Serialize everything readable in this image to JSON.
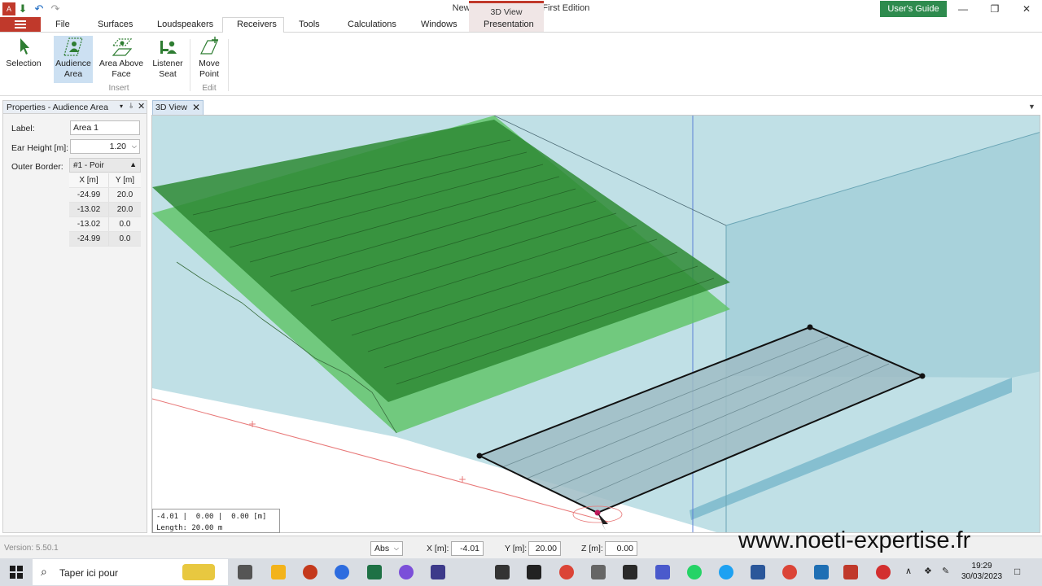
{
  "window": {
    "title": "New Project - EASE 5 First Edition",
    "context_group": "3D View",
    "users_guide": "User's Guide"
  },
  "tabs": [
    "File",
    "Surfaces",
    "Loudspeakers",
    "Receivers",
    "Tools",
    "Calculations",
    "Windows",
    "Presentation"
  ],
  "ribbon": {
    "selection": "Selection",
    "audience_area": "Audience\nArea",
    "area_above_face": "Area Above\nFace",
    "listener_seat": "Listener\nSeat",
    "move_point": "Move\nPoint",
    "group_insert": "Insert",
    "group_edit": "Edit"
  },
  "properties": {
    "title": "Properties - Audience Area",
    "label_caption": "Label:",
    "label_value": "Area 1",
    "ear_height_caption": "Ear Height [m]:",
    "ear_height_value": "1.20",
    "outer_border_caption": "Outer Border:",
    "outer_border_value": "#1 - Poir",
    "col_x": "X [m]",
    "col_y": "Y [m]",
    "rows": [
      {
        "x": "-24.99",
        "y": "20.0"
      },
      {
        "x": "-13.02",
        "y": "20.0"
      },
      {
        "x": "-13.02",
        "y": "0.0"
      },
      {
        "x": "-24.99",
        "y": "0.0"
      }
    ]
  },
  "document": {
    "tab": "3D View",
    "coord_line1": "-4.01 |  0.00 |  0.00 [m]",
    "coord_line2": "Length: 20.00 m"
  },
  "status": {
    "version": "Version: 5.50.1",
    "mode": "Abs",
    "x_label": "X [m]:",
    "x_value": "-4.01",
    "y_label": "Y [m]:",
    "y_value": "20.00",
    "z_label": "Z [m]:",
    "z_value": "0.00"
  },
  "watermark": "www.noeti-expertise.fr",
  "taskbar": {
    "search_placeholder": "Taper ici pour",
    "time": "19:29",
    "date": "30/03/2023"
  }
}
